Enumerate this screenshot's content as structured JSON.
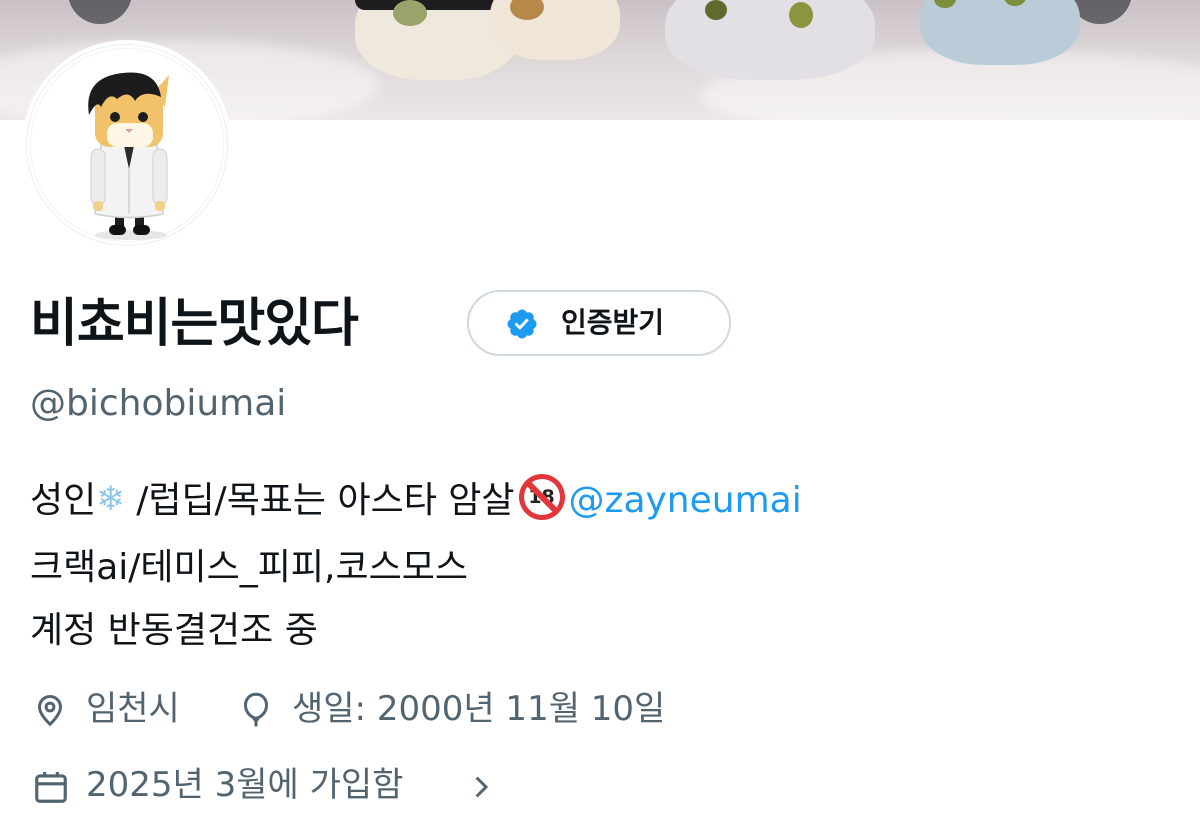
{
  "profile": {
    "display_name": "비쵸비는맛있다",
    "handle": "@bichobiumai",
    "avatar_icon": "character-avatar-icon",
    "banner_icon": "plush-dolls-banner-icon"
  },
  "verify_button": {
    "label": "인증받기",
    "icon": "verified-badge-icon"
  },
  "bio": {
    "line1_prefix": "성인",
    "line1_emoji_snow": "❄",
    "line1_mid": " /럽딥/목표는 아스타 암살",
    "line1_emoji_18": "18",
    "line1_mention": "@zayneumai",
    "line2": "크랙ai/테미스_피피,코스모스",
    "line3": "계정 반동결건조 중"
  },
  "meta": {
    "location": "임천시",
    "location_icon": "location-pin-icon",
    "birthday": "생일: 2000년 11월 10일",
    "birthday_icon": "balloon-icon",
    "joined": "2025년 3월에 가입함",
    "joined_icon": "calendar-icon",
    "joined_chevron_icon": "chevron-right-icon"
  },
  "colors": {
    "accent": "#1d9bf0",
    "text_primary": "#0f1419",
    "text_secondary": "#536471",
    "border": "#cfd9de",
    "no18_red": "#e2363a"
  }
}
